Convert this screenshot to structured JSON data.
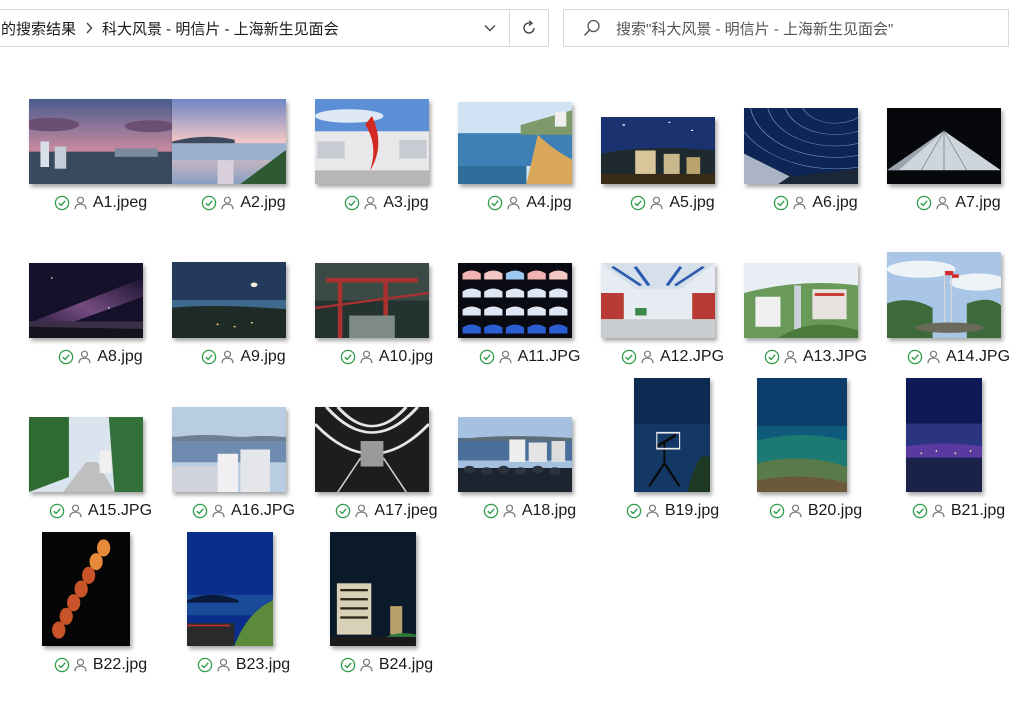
{
  "address_bar": {
    "crumbs": [
      "的搜索结果",
      "科大风景 - 明信片 - 上海新生见面会"
    ]
  },
  "search": {
    "placeholder": "搜索\"科大风景 - 明信片 - 上海新生见面会\""
  },
  "colors": {
    "sync_ok": "#2e9c4a",
    "user_icon": "#7a7a7a",
    "border": "#d9d9d9"
  },
  "files": [
    {
      "name": "A1.jpeg",
      "scene": "sunset-city"
    },
    {
      "name": "A2.jpg",
      "scene": "dusk-bay"
    },
    {
      "name": "A3.jpg",
      "scene": "campus-sculpture"
    },
    {
      "name": "A4.jpg",
      "scene": "beach"
    },
    {
      "name": "A5.jpg",
      "scene": "night-campus"
    },
    {
      "name": "A6.jpg",
      "scene": "star-trails"
    },
    {
      "name": "A7.jpg",
      "scene": "dark-building"
    },
    {
      "name": "A8.jpg",
      "scene": "milky-way"
    },
    {
      "name": "A9.jpg",
      "scene": "moon-sea"
    },
    {
      "name": "A10.jpg",
      "scene": "red-railing"
    },
    {
      "name": "A11.JPG",
      "scene": "arch-windows"
    },
    {
      "name": "A12.JPG",
      "scene": "corridor"
    },
    {
      "name": "A13.JPG",
      "scene": "hill-buildings"
    },
    {
      "name": "A14.JPG",
      "scene": "flagpoles"
    },
    {
      "name": "A15.JPG",
      "scene": "green-path"
    },
    {
      "name": "A16.JPG",
      "scene": "harbour-view"
    },
    {
      "name": "A17.jpeg",
      "scene": "bw-atrium"
    },
    {
      "name": "A18.jpg",
      "scene": "crowd-view"
    },
    {
      "name": "B19.jpg",
      "scene": "basket-night"
    },
    {
      "name": "B20.jpg",
      "scene": "teal-sea"
    },
    {
      "name": "B21.jpg",
      "scene": "purple-coast"
    },
    {
      "name": "B22.jpg",
      "scene": "moon-phases"
    },
    {
      "name": "B23.jpg",
      "scene": "blue-hour"
    },
    {
      "name": "B24.jpg",
      "scene": "night-building"
    }
  ]
}
